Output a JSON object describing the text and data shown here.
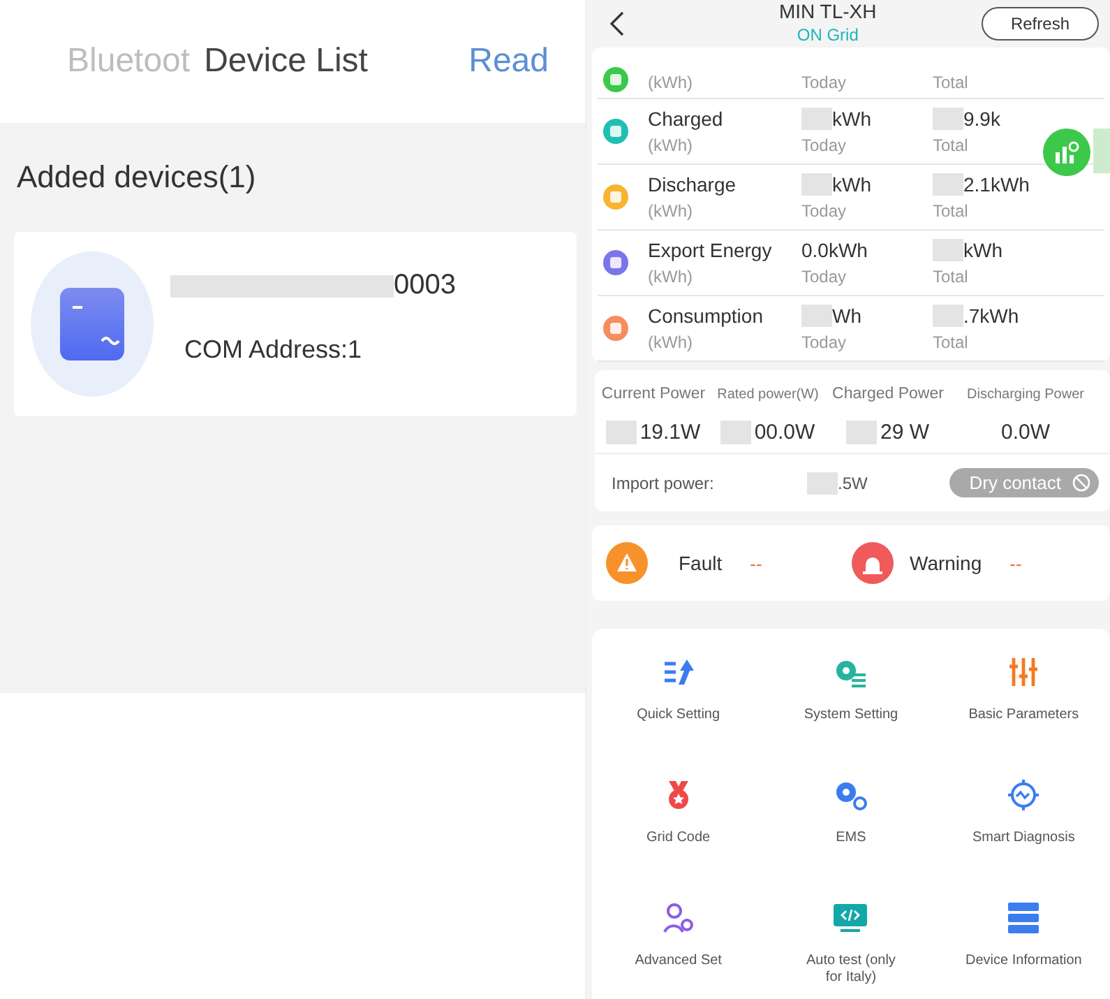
{
  "device_list": {
    "tab_behind": "Bluetoot",
    "title": "Device List",
    "action": "Read",
    "section": "Added devices(1)",
    "devices": [
      {
        "name": "0003",
        "name_masked": true,
        "address": "COM Address:1"
      }
    ]
  },
  "inverter": {
    "title": "MIN TL-XH",
    "status": "ON Grid",
    "refresh": "Refresh",
    "energy": [
      {
        "unit": "(kWh)",
        "today_label": "Today",
        "total_label": "Total",
        "color": "#3cc84a"
      },
      {
        "label": "Charged",
        "unit": "(kWh)",
        "today": "kWh",
        "today_masked": true,
        "today_label": "Today",
        "total": "9.9k",
        "total_masked": true,
        "total_label": "Total",
        "color": "#1fbfb3"
      },
      {
        "label": "Discharge",
        "unit": "(kWh)",
        "today": "kWh",
        "today_masked": true,
        "today_label": "Today",
        "total": "2.1kWh",
        "total_masked": true,
        "total_label": "Total",
        "color": "#f8b430"
      },
      {
        "label": "Export Energy",
        "unit": "(kWh)",
        "today": "0.0kWh",
        "today_masked": false,
        "today_label": "Today",
        "total": "kWh",
        "total_masked": true,
        "total_label": "Total",
        "color": "#7a76e8"
      },
      {
        "label": "Consumption",
        "unit": "(kWh)",
        "today": "Wh",
        "today_masked": true,
        "today_label": "Today",
        "total": ".7kWh",
        "total_masked": true,
        "total_label": "Total",
        "color": "#f58d5e"
      }
    ],
    "power": [
      {
        "label": "Current Power",
        "value": "19.1W",
        "masked": true
      },
      {
        "label": "Rated power(W)",
        "value": "00.0W",
        "masked": true
      },
      {
        "label": "Charged Power",
        "value": "29 W",
        "masked": true
      },
      {
        "label": "Discharging Power",
        "value": "0.0W",
        "masked": false
      }
    ],
    "import": {
      "label": "Import power:",
      "value": ".5W",
      "masked": true
    },
    "dry_contact": {
      "label": "Dry contact",
      "disabled": true
    },
    "alarms": [
      {
        "kind": "fault",
        "label": "Fault",
        "value": "--"
      },
      {
        "kind": "warning",
        "label": "Warning",
        "value": "--"
      }
    ],
    "menu": [
      {
        "kind": "quick",
        "label": "Quick Setting"
      },
      {
        "kind": "system",
        "label": "System Setting"
      },
      {
        "kind": "basic",
        "label": "Basic Parameters"
      },
      {
        "kind": "grid",
        "label": "Grid Code"
      },
      {
        "kind": "ems",
        "label": "EMS"
      },
      {
        "kind": "diagnosis",
        "label": "Smart Diagnosis"
      },
      {
        "kind": "advanced",
        "label": "Advanced Set"
      },
      {
        "kind": "autotest",
        "label": "Auto test (only for Italy)"
      },
      {
        "kind": "info",
        "label": "Device Information"
      }
    ]
  }
}
